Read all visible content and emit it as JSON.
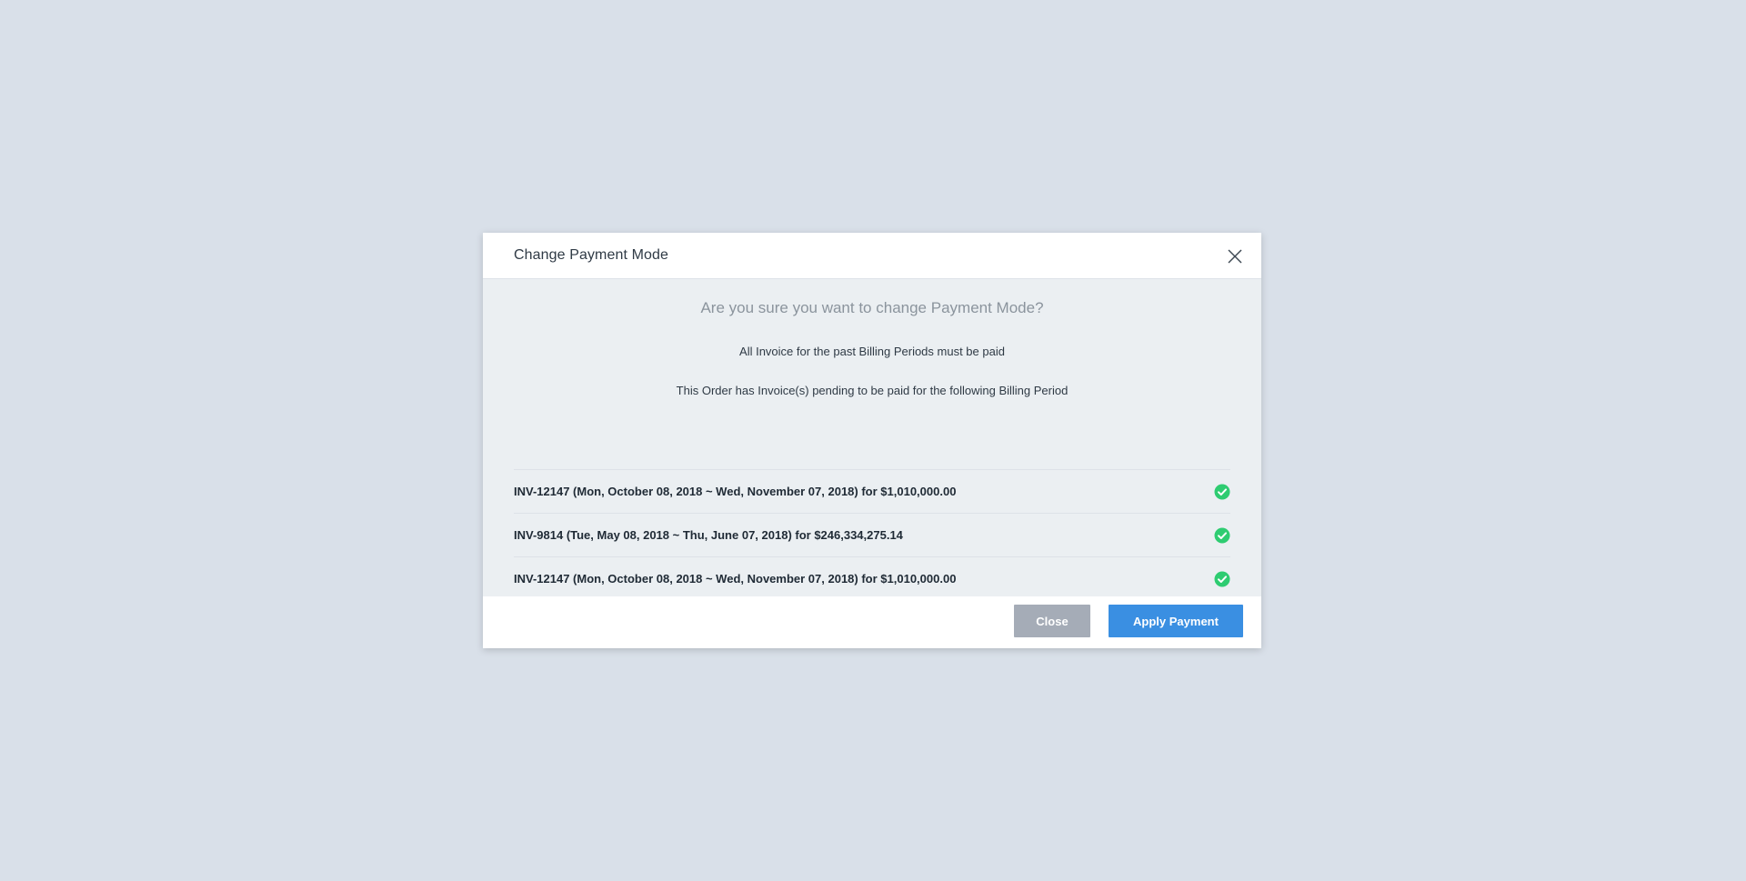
{
  "modal": {
    "title": "Change Payment Mode",
    "close_icon": "close-icon",
    "heading": "Are you sure you want to change Payment Mode?",
    "line1": "All Invoice for the past Billing Periods must be paid",
    "line2": "This Order has Invoice(s) pending to be paid for the following Billing Period",
    "invoices": [
      {
        "text": "INV-12147 (Mon, October 08, 2018 ~ Wed, November 07, 2018) for $1,010,000.00",
        "status_icon": "check-circle-icon"
      },
      {
        "text": "INV-9814 (Tue, May 08, 2018 ~ Thu, June 07, 2018) for $246,334,275.14",
        "status_icon": "check-circle-icon"
      },
      {
        "text": "INV-12147 (Mon, October 08, 2018 ~ Wed, November 07, 2018) for $1,010,000.00",
        "status_icon": "check-circle-icon"
      }
    ],
    "footer": {
      "close_label": "Close",
      "apply_label": "Apply Payment"
    }
  },
  "colors": {
    "page_background": "#d9e0e9",
    "modal_body": "#ebeff2",
    "check_green": "#2ecc71",
    "apply_button": "#3a8fe2",
    "close_button": "#a5acb7"
  }
}
